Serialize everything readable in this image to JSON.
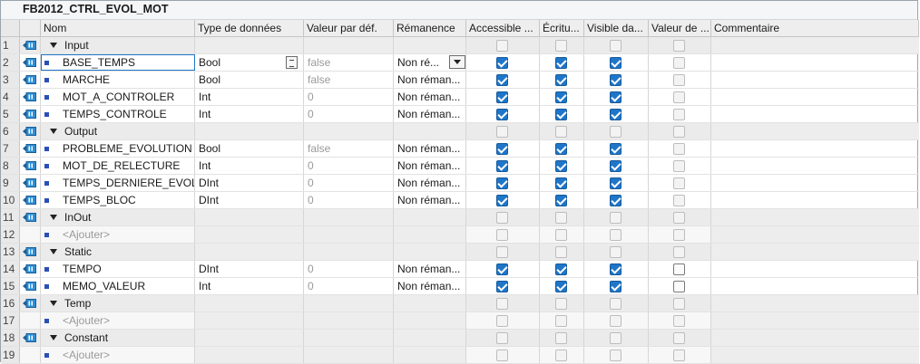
{
  "block_title": "FB2012_CTRL_EVOL_MOT",
  "columns": [
    "Nom",
    "Type de données",
    "Valeur par déf.",
    "Rémanence",
    "Accessible ...",
    "Écritu...",
    "Visible da...",
    "Valeur de ...",
    "Commentaire"
  ],
  "rows": [
    {
      "num": "1",
      "kind": "section",
      "name": "Input",
      "type": "",
      "default": "",
      "retain": "",
      "acc": "off",
      "ecr": "off",
      "vis": "off",
      "val": "off"
    },
    {
      "num": "2",
      "kind": "var",
      "name": "BASE_TEMPS",
      "type": "Bool",
      "default": "false",
      "retain": "Non ré...",
      "acc": "on",
      "ecr": "on",
      "vis": "on",
      "val": "off"
    },
    {
      "num": "3",
      "kind": "var",
      "name": "MARCHE",
      "type": "Bool",
      "default": "false",
      "retain": "Non réman...",
      "acc": "on",
      "ecr": "on",
      "vis": "on",
      "val": "off"
    },
    {
      "num": "4",
      "kind": "var",
      "name": "MOT_A_CONTROLER",
      "type": "Int",
      "default": "0",
      "retain": "Non réman...",
      "acc": "on",
      "ecr": "on",
      "vis": "on",
      "val": "off"
    },
    {
      "num": "5",
      "kind": "var",
      "name": "TEMPS_CONTROLE",
      "type": "Int",
      "default": "0",
      "retain": "Non réman...",
      "acc": "on",
      "ecr": "on",
      "vis": "on",
      "val": "off"
    },
    {
      "num": "6",
      "kind": "section",
      "name": "Output",
      "type": "",
      "default": "",
      "retain": "",
      "acc": "off",
      "ecr": "off",
      "vis": "off",
      "val": "off"
    },
    {
      "num": "7",
      "kind": "var",
      "name": "PROBLEME_EVOLUTION",
      "type": "Bool",
      "default": "false",
      "retain": "Non réman...",
      "acc": "on",
      "ecr": "on",
      "vis": "on",
      "val": "off"
    },
    {
      "num": "8",
      "kind": "var",
      "name": "MOT_DE_RELECTURE",
      "type": "Int",
      "default": "0",
      "retain": "Non réman...",
      "acc": "on",
      "ecr": "on",
      "vis": "on",
      "val": "off"
    },
    {
      "num": "9",
      "kind": "var",
      "name": "TEMPS_DERNIERE_EVOL",
      "type": "DInt",
      "default": "0",
      "retain": "Non réman...",
      "acc": "on",
      "ecr": "on",
      "vis": "on",
      "val": "off"
    },
    {
      "num": "10",
      "kind": "var",
      "name": "TEMPS_BLOC",
      "type": "DInt",
      "default": "0",
      "retain": "Non réman...",
      "acc": "on",
      "ecr": "on",
      "vis": "on",
      "val": "off"
    },
    {
      "num": "11",
      "kind": "section",
      "name": "InOut",
      "type": "",
      "default": "",
      "retain": "",
      "acc": "off",
      "ecr": "off",
      "vis": "off",
      "val": "off"
    },
    {
      "num": "12",
      "kind": "placeholder",
      "name": "<Ajouter>",
      "type": "",
      "default": "",
      "retain": "",
      "acc": "off",
      "ecr": "off",
      "vis": "off",
      "val": "off"
    },
    {
      "num": "13",
      "kind": "section",
      "name": "Static",
      "type": "",
      "default": "",
      "retain": "",
      "acc": "off",
      "ecr": "off",
      "vis": "off",
      "val": "off"
    },
    {
      "num": "14",
      "kind": "var",
      "name": "TEMPO",
      "type": "DInt",
      "default": "0",
      "retain": "Non réman...",
      "acc": "on",
      "ecr": "on",
      "vis": "on",
      "val": "off-strong"
    },
    {
      "num": "15",
      "kind": "var",
      "name": "MEMO_VALEUR",
      "type": "Int",
      "default": "0",
      "retain": "Non réman...",
      "acc": "on",
      "ecr": "on",
      "vis": "on",
      "val": "off-strong"
    },
    {
      "num": "16",
      "kind": "section",
      "name": "Temp",
      "type": "",
      "default": "",
      "retain": "",
      "acc": "off",
      "ecr": "off",
      "vis": "off",
      "val": "off"
    },
    {
      "num": "17",
      "kind": "placeholder",
      "name": "<Ajouter>",
      "type": "",
      "default": "",
      "retain": "",
      "acc": "off",
      "ecr": "off",
      "vis": "off",
      "val": "off"
    },
    {
      "num": "18",
      "kind": "section",
      "name": "Constant",
      "type": "",
      "default": "",
      "retain": "",
      "acc": "off",
      "ecr": "off",
      "vis": "off",
      "val": "off"
    },
    {
      "num": "19",
      "kind": "placeholder",
      "name": "<Ajouter>",
      "type": "",
      "default": "",
      "retain": "",
      "acc": "off",
      "ecr": "off",
      "vis": "off",
      "val": "off"
    }
  ],
  "selected_row": "2",
  "icons": {
    "interface": "interface-io-icon",
    "member": "member-dot-icon",
    "expand": "expand-triangle-icon"
  },
  "colors": {
    "checkbox_on": "#1f76c9",
    "member_dot": "#2b4fb5",
    "io_icon": "#2d8fd5"
  }
}
